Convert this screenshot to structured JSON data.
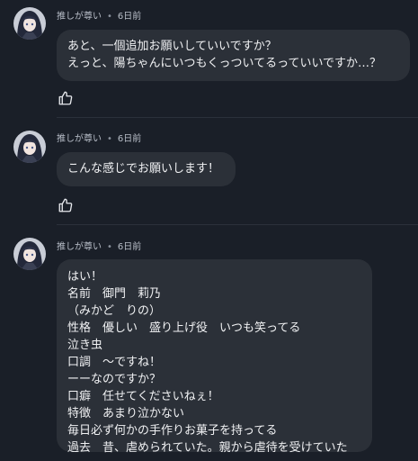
{
  "comments": [
    {
      "author": "推しが尊い",
      "separator": "•",
      "time": "6日前",
      "lines": [
        "あと、一個追加お願いしていいですか？",
        "えっと、陽ちゃんにいつもくっついてるっていいですか…？"
      ]
    },
    {
      "author": "推しが尊い",
      "separator": "•",
      "time": "6日前",
      "lines": [
        "こんな感じでお願いします！"
      ]
    },
    {
      "author": "推しが尊い",
      "separator": "•",
      "time": "6日前",
      "lines": [
        "はい！",
        "名前　御門　莉乃",
        "（みかど　りの）",
        "性格　優しい　盛り上げ役　いつも笑ってる",
        "泣き虫",
        "口調　〜ですね！",
        "ーーなのですか？",
        "口癖　任せてくださいねぇ！",
        "特徴　あまり泣かない",
        "毎日必ず何かの手作りお菓子を持ってる",
        "過去　昔、虐められていた。親から虐待を受けていた"
      ]
    }
  ],
  "icons": {
    "like": "thumbs-up-icon",
    "avatar": "anime-girl-avatar"
  },
  "colors": {
    "background": "#1a1f28",
    "bubble": "#2b3038",
    "meta_text": "#b8bec8"
  }
}
